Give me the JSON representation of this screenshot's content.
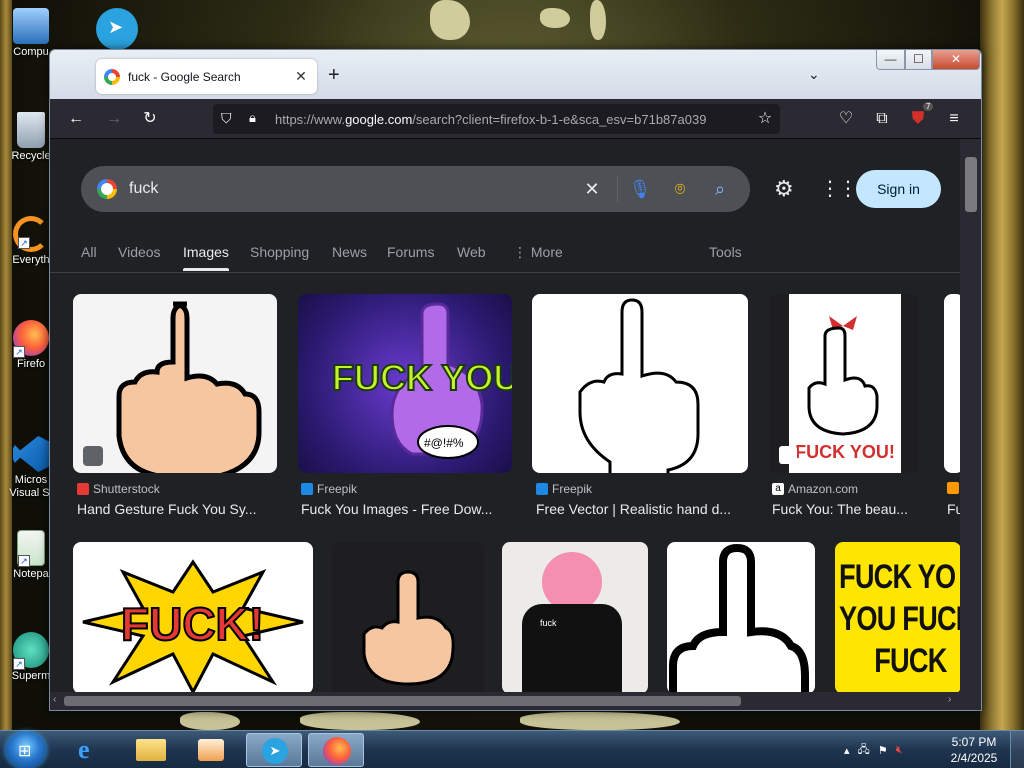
{
  "desktop": {
    "icons": [
      {
        "label": "Compu",
        "name": "desktop-icon-computer"
      },
      {
        "label": "Recycle",
        "name": "desktop-icon-recycle-bin"
      },
      {
        "label": "Everyth",
        "name": "desktop-icon-everything"
      },
      {
        "label": "Firefo",
        "name": "desktop-icon-firefox"
      },
      {
        "label": "Micros Visual St",
        "name": "desktop-icon-vscode"
      },
      {
        "label": "Notepa",
        "name": "desktop-icon-notepad"
      },
      {
        "label": "Superm",
        "name": "desktop-icon-supermium"
      }
    ]
  },
  "browser": {
    "tab_title": "fuck - Google Search",
    "new_tab_symbol": "+",
    "url_prefix": "https://www.",
    "url_domain": "google.com",
    "url_rest": "/search?client=firefox-b-1-e&sca_esv=b71b87a039",
    "extension_badge": "7"
  },
  "google": {
    "query": "fuck",
    "sign_in": "Sign in",
    "tabs": [
      "All",
      "Videos",
      "Images",
      "Shopping",
      "News",
      "Forums",
      "Web",
      "More"
    ],
    "active_tab": "Images",
    "tools": "Tools",
    "results_row1": [
      {
        "source": "Shutterstock",
        "title": "Hand Gesture Fuck You Sy...",
        "fav_color": "#e53935"
      },
      {
        "source": "Freepik",
        "title": "Fuck You Images - Free Dow...",
        "fav_color": "#1e88e5"
      },
      {
        "source": "Freepik",
        "title": "Free Vector | Realistic hand d...",
        "fav_color": "#1e88e5"
      },
      {
        "source": "Amazon.com",
        "title": "Fuck You: The beau...",
        "fav_color": "#ffffff"
      },
      {
        "source": "",
        "title": "Fu",
        "fav_color": "#ff9800"
      }
    ],
    "image_texts": {
      "freepik_art": "FUCK YOU!",
      "freepik_bubble": "#@!#%",
      "amazon_art": "FUCK YOU!",
      "comic_art": "FUCK!",
      "yellow_sign": [
        "FUCK YO",
        "YOU FUCK",
        "FUCK"
      ],
      "tshirt": "fuck"
    }
  },
  "taskbar": {
    "time": "5:07 PM",
    "date": "2/4/2025"
  },
  "colors": {
    "page_bg": "#202124",
    "sign_in_bg": "#c2e7ff",
    "firefox_toolbar": "#2b2a33"
  }
}
